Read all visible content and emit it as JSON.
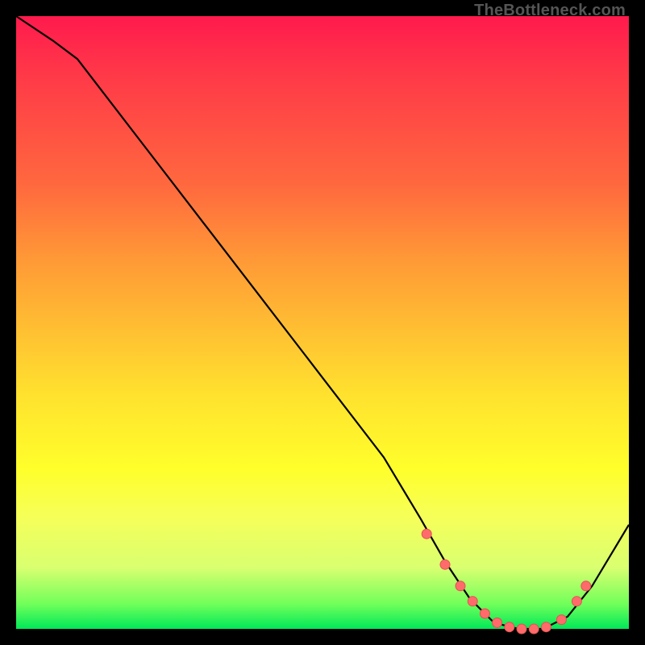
{
  "watermark": "TheBottleneck.com",
  "colors": {
    "frame_bg": "#000000",
    "curve": "#000000",
    "dot_fill": "#ff6b6b",
    "dot_stroke": "#e05252"
  },
  "chart_data": {
    "type": "line",
    "title": "",
    "xlabel": "",
    "ylabel": "",
    "xlim": [
      0,
      100
    ],
    "ylim": [
      0,
      100
    ],
    "series": [
      {
        "name": "curve",
        "x": [
          0,
          6,
          10,
          20,
          30,
          40,
          50,
          60,
          66,
          70,
          74,
          78,
          82,
          86,
          90,
          94,
          100
        ],
        "y": [
          100,
          96,
          93,
          80,
          67,
          54,
          41,
          28,
          18,
          11,
          5,
          1,
          0,
          0,
          2,
          7,
          17
        ]
      }
    ],
    "markers": {
      "name": "highlight-dots",
      "x": [
        67,
        70,
        72.5,
        74.5,
        76.5,
        78.5,
        80.5,
        82.5,
        84.5,
        86.5,
        89,
        91.5,
        93
      ],
      "y": [
        15.5,
        10.5,
        7,
        4.5,
        2.5,
        1,
        0.3,
        0,
        0,
        0.3,
        1.5,
        4.5,
        7
      ]
    }
  }
}
